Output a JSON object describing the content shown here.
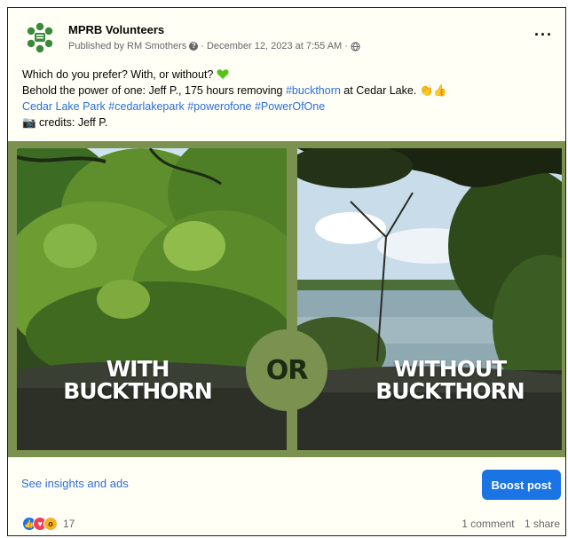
{
  "post": {
    "page_name": "MPRB Volunteers",
    "published_by": "Published by RM Smothers",
    "date": "December 12, 2023 at 7:55 AM",
    "separator": "·",
    "more_label": "···",
    "lines": {
      "l1": "Which do you prefer? With, or without?",
      "l2_prefix": "Behold the power of one: Jeff P., 175 hours removing ",
      "l2_hashtag": "#buckthorn",
      "l2_suffix": " at Cedar Lake.",
      "l2_emojis": "👏👍",
      "l3_place": "Cedar Lake Park",
      "l3_tags": " #cedarlakepark #powerofone #PowerOfOne",
      "l4_camera": "📷",
      "l4_text": " credits: Jeff P."
    }
  },
  "image": {
    "left_label_1": "WITH",
    "left_label_2": "BUCKTHORN",
    "or_label": "OR",
    "right_label_1": "WITHOUT",
    "right_label_2": "BUCKTHORN",
    "frame_color": "#7b9150"
  },
  "footer": {
    "insights_label": "See insights and ads",
    "boost_label": "Boost post",
    "reaction_count": "17",
    "comments": "1 comment",
    "shares": "1 share"
  },
  "icons": {
    "avatar": "mprb-logo-icon",
    "privacy": "globe-icon",
    "info": "info-icon",
    "heart": "green-heart-icon",
    "reactions": [
      "like-icon",
      "love-icon",
      "wow-icon"
    ]
  },
  "colors": {
    "link": "#2b6fd6",
    "boost_button": "#1b74e4",
    "card_bg": "#fffff5",
    "heart": "#52c41a"
  }
}
